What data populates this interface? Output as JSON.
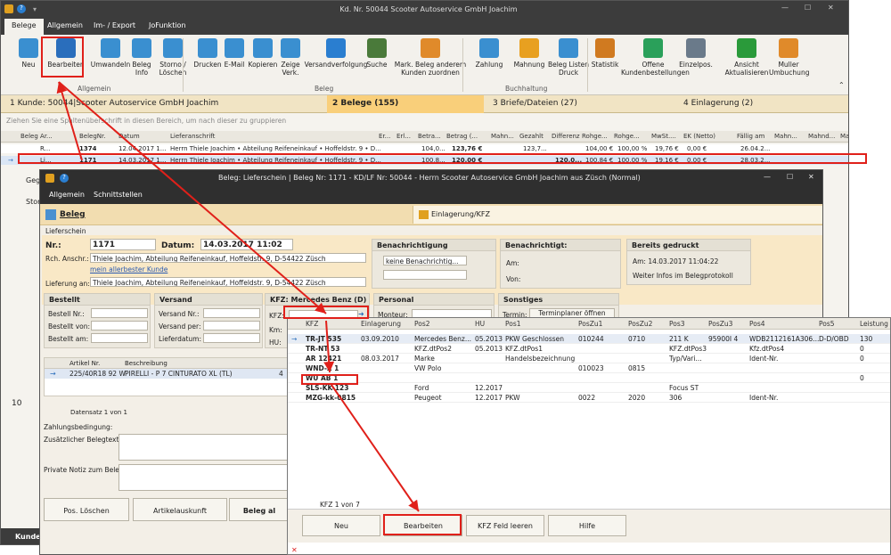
{
  "main": {
    "title": "Kd. Nr. 50044 Scooter Autoservice GmbH Joachim",
    "tabs": [
      "Belege",
      "Allgemein",
      "Im- / Export",
      "JoFunktion"
    ],
    "ribbon": [
      {
        "label": "Neu",
        "icon": "plus-icon",
        "color": "#3a8fd0"
      },
      {
        "label": "Bearbeiten",
        "icon": "pencil-icon",
        "color": "#2a6ebc"
      },
      {
        "label": "Umwandeln",
        "icon": "convert-icon",
        "color": "#3a8fd0"
      },
      {
        "label": "Beleg Info",
        "icon": "info-icon",
        "color": "#3a8fd0"
      },
      {
        "label": "Storno / Löschen",
        "icon": "minus-icon",
        "color": "#3a8fd0"
      },
      {
        "label": "Drucken",
        "icon": "printer-icon",
        "color": "#3a8fd0"
      },
      {
        "label": "E-Mail",
        "icon": "email-icon",
        "color": "#3a8fd0"
      },
      {
        "label": "Kopieren",
        "icon": "copy-icon",
        "color": "#3a8fd0"
      },
      {
        "label": "Zeige Verk.",
        "icon": "network-icon",
        "color": "#3a8fd0"
      },
      {
        "label": "Versandverfolgung",
        "icon": "truck-icon",
        "color": "#2a7ed0"
      },
      {
        "label": "Suche",
        "icon": "binoculars-icon",
        "color": "#4a7a3a"
      },
      {
        "label": "Mark. Beleg anderem Kunden zuordnen",
        "icon": "users-icon",
        "color": "#e08a2a"
      },
      {
        "label": "Zahlung",
        "icon": "payment-icon",
        "color": "#3a8fd0"
      },
      {
        "label": "Mahnung",
        "icon": "reminder-icon",
        "color": "#e8a020"
      },
      {
        "label": "Beleg Listen Druck",
        "icon": "list-print-icon",
        "color": "#3a8fd0"
      },
      {
        "label": "Statistik",
        "icon": "chart-icon",
        "color": "#d07a20"
      },
      {
        "label": "Offene Kundenbestellungen",
        "icon": "cart-icon",
        "color": "#2aa05a"
      },
      {
        "label": "Einzelpos.",
        "icon": "document-icon",
        "color": "#6a7a8a"
      },
      {
        "label": "Ansicht Aktualisieren",
        "icon": "refresh-icon",
        "color": "#2a9a3a"
      },
      {
        "label": "Muller Umbuchung",
        "icon": "person-icon",
        "color": "#e08a2a"
      }
    ],
    "groups": [
      "Allgemein",
      "Beleg",
      "Buchhaltung"
    ],
    "nav": [
      "1 Kunde: 50044|Scooter Autoservice GmbH Joachim",
      "2 Belege (155)",
      "3 Briefe/Dateien (27)",
      "4 Einlagerung (2)"
    ],
    "hint": "Ziehen Sie eine Spaltenüberschrift in diesen Bereich, um nach dieser zu gruppieren",
    "grid_headers": [
      "Beleg Ar...",
      "BelegNr.",
      "Datum",
      "Lieferanschrift",
      "Er...",
      "Erl...",
      "Betra...",
      "Betrag (...",
      "Mahn...",
      "Gezahlt",
      "Differenz",
      "Rohge...",
      "Rohge...",
      "MwSt....",
      "EK (Netto)",
      "Fällig am",
      "Mahn...",
      "Mahnd...",
      "Ma"
    ],
    "grid_rows": [
      [
        "R...",
        "1374",
        "12.04.2017 1...",
        "Herrn Thiele Joachim • Abteilung Reifeneinkauf • Hoffeldstr. 9 • D...",
        "",
        "",
        "104,0...",
        "123,76 €",
        "",
        "123,7...",
        "",
        "104,00 €",
        "100,00 %",
        "19,76 €",
        "0,00 €",
        "26.04.2...",
        "",
        ""
      ],
      [
        "Li...",
        "1171",
        "14.03.2017 1...",
        "Herrn Thiele Joachim • Abteilung Reifeneinkauf • Hoffeldstr. 9 • D...",
        "",
        "",
        "100,8...",
        "120,00 €",
        "",
        "",
        "120,0...",
        "100,84 €",
        "100,00 %",
        "19,16 €",
        "0,00 €",
        "28.03.2...",
        "",
        ""
      ]
    ],
    "left_labels": [
      "Geg",
      "Stor"
    ],
    "bottom_label": "Kunde",
    "page_num": "10"
  },
  "dialog": {
    "title": "Beleg: Lieferschein | Beleg Nr: 1171 - KD/LF Nr: 50044 - Herrn Scooter Autoservice GmbH Joachim aus Züsch (Normal)",
    "tabs": [
      "Allgemein",
      "Schnittstellen"
    ],
    "panel_tabs": [
      "Beleg",
      "Einlagerung/KFZ"
    ],
    "section": "Lieferschein",
    "nr_label": "Nr.:",
    "nr": "1171",
    "datum_label": "Datum:",
    "datum": "14.03.2017 11:02",
    "rch_label": "Rch. Anschr.:",
    "rch": "Thiele Joachim, Abteilung Reifeneinkauf, Hoffeldstr. 9,  D-54422 Züsch",
    "kunde_link": "mein allerbester Kunde",
    "lief_label": "Lieferung an:",
    "lief": "Thiele Joachim, Abteilung Reifeneinkauf, Hoffeldstr. 9,  D-54422 Züsch",
    "benach_title": "Benachrichtigung",
    "benach_value": "keine Benachrichtig...",
    "benachrichtigt_title": "Benachrichtigt:",
    "am_label": "Am:",
    "von_label": "Von:",
    "gedruckt_title": "Bereits gedruckt",
    "gedruckt_am": "Am:   14.03.2017 11:04:22",
    "gedruckt_info": "Weiter Infos im Belegprotokoll",
    "bestellt_title": "Bestellt",
    "bestellt": [
      "Bestell Nr.:",
      "Bestellt von:",
      "Bestellt am:"
    ],
    "versand_title": "Versand",
    "versand": [
      "Versand Nr.:",
      "Versand per:",
      "Lieferdatum:"
    ],
    "kfz_title": "KFZ: Mercedes Benz (D)",
    "kfz": [
      "KFZ:",
      "Km:",
      "HU:"
    ],
    "personal_title": "Personal",
    "monteur": "Monteur:",
    "sonstiges_title": "Sonstiges",
    "termin": "Termin:",
    "terminplaner": "Terminplaner öffnen",
    "art_headers": [
      "Artikel Nr.",
      "Beschreibung"
    ],
    "art_row": [
      "225/40R18 92 W",
      "PIRELLI - P 7 CINTURATO XL (TL)"
    ],
    "art_qty": "4",
    "datensatz": "Datensatz 1 von 1",
    "zahlung": "Zahlungsbedingung:",
    "zusatz": "Zusätzlicher Belegtext:",
    "notiz": "Private Notiz zum Beleg:",
    "buttons": [
      "Pos. Löschen",
      "Artikelauskunft",
      "Beleg al"
    ]
  },
  "kfz_popup": {
    "headers": [
      "KFZ",
      "Einlagerung",
      "Pos2",
      "HU",
      "Pos1",
      "PosZu1",
      "PosZu2",
      "Pos3",
      "PosZu3",
      "Pos4",
      "Pos5",
      "Leistung"
    ],
    "rows": [
      [
        "TR-JT 535",
        "03.09.2010",
        "Mercedes Benz...",
        "05.2013",
        "PKW Geschlossen",
        "010244",
        "0710",
        "211 K",
        "95900I 4",
        "WDB2112161A306...",
        "D-D/OBD",
        "130"
      ],
      [
        "TR-NT 53",
        "",
        "KFZ.dtPos2",
        "05.2013",
        "KFZ.dtPos1",
        "",
        "",
        "KFZ.dtPos3",
        "",
        "Kfz.dtPos4",
        "",
        "0"
      ],
      [
        "AR 12421",
        "08.03.2017",
        "Marke",
        "",
        "Handelsbezeichnung",
        "",
        "",
        "Typ/Vari...",
        "",
        "Ident-Nr.",
        "",
        "0"
      ],
      [
        "WND-Z 1",
        "",
        "VW Polo",
        "",
        "",
        "010023",
        "0815",
        "",
        "",
        "",
        "",
        ""
      ],
      [
        "WU AB 1",
        "",
        "",
        "",
        "",
        "",
        "",
        "",
        "",
        "",
        "",
        "0"
      ],
      [
        "SLS-KK-123",
        "",
        "Ford",
        "12.2017",
        "",
        "",
        "",
        "Focus ST",
        "",
        "",
        "",
        ""
      ],
      [
        "MZG-kk-0815",
        "",
        "Peugeot",
        "12.2017",
        "PKW",
        "0022",
        "2020",
        "306",
        "",
        "Ident-Nr.",
        "",
        ""
      ]
    ],
    "pager": "KFZ 1 von 7",
    "buttons": [
      "Neu",
      "Bearbeiten",
      "KFZ Feld leeren",
      "Hilfe"
    ]
  }
}
